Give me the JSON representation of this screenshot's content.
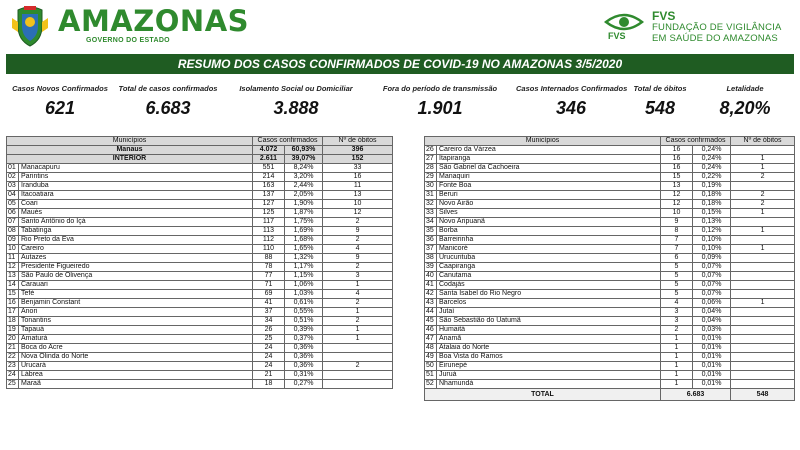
{
  "header": {
    "brand_name": "AMAZONAS",
    "brand_sub": "GOVERNO DO ESTADO",
    "fvs_abbr": "FVS",
    "fvs_line1": "FUNDAÇÃO DE VIGILÂNCIA",
    "fvs_line2": "EM SAÚDE DO AMAZONAS"
  },
  "banner": "RESUMO DOS CASOS CONFIRMADOS DE COVID-19 NO AMAZONAS 3/5/2020",
  "stats": [
    {
      "label": "Casos Novos Confirmados",
      "value": "621"
    },
    {
      "label": "Total de casos confirmados",
      "value": "6.683"
    },
    {
      "label": "Isolamento Social ou Domiciliar",
      "value": "3.888"
    },
    {
      "label": "Fora do período de transmissão",
      "value": "1.901"
    },
    {
      "label": "Casos Internados Confirmados",
      "value": "346"
    },
    {
      "label": "Total de óbitos",
      "value": "548"
    },
    {
      "label": "Letalidade",
      "value": "8,20%"
    }
  ],
  "table_headers": {
    "municipios": "Municípios",
    "casos": "Casos confirmados",
    "obitos": "Nº de óbitos"
  },
  "summary_rows": [
    {
      "name": "Manaus",
      "cases": "4.072",
      "pct": "60,93%",
      "deaths": "396"
    },
    {
      "name": "INTERIOR",
      "cases": "2.611",
      "pct": "39,07%",
      "deaths": "152"
    }
  ],
  "left_rows": [
    {
      "n": "01",
      "name": "Manacapuru",
      "cases": "551",
      "pct": "8,24%",
      "deaths": "33"
    },
    {
      "n": "02",
      "name": "Parintins",
      "cases": "214",
      "pct": "3,20%",
      "deaths": "16"
    },
    {
      "n": "03",
      "name": "Iranduba",
      "cases": "163",
      "pct": "2,44%",
      "deaths": "11"
    },
    {
      "n": "04",
      "name": "Itacoatiara",
      "cases": "137",
      "pct": "2,05%",
      "deaths": "13"
    },
    {
      "n": "05",
      "name": "Coari",
      "cases": "127",
      "pct": "1,90%",
      "deaths": "10"
    },
    {
      "n": "06",
      "name": "Maués",
      "cases": "125",
      "pct": "1,87%",
      "deaths": "12"
    },
    {
      "n": "07",
      "name": "Santo Antônio do Içá",
      "cases": "117",
      "pct": "1,75%",
      "deaths": "2"
    },
    {
      "n": "08",
      "name": "Tabatinga",
      "cases": "113",
      "pct": "1,69%",
      "deaths": "9"
    },
    {
      "n": "09",
      "name": "Rio Preto da Eva",
      "cases": "112",
      "pct": "1,68%",
      "deaths": "2"
    },
    {
      "n": "10",
      "name": "Careiro",
      "cases": "110",
      "pct": "1,65%",
      "deaths": "4"
    },
    {
      "n": "11",
      "name": "Autazes",
      "cases": "88",
      "pct": "1,32%",
      "deaths": "9"
    },
    {
      "n": "12",
      "name": "Presidente Figueiredo",
      "cases": "78",
      "pct": "1,17%",
      "deaths": "2"
    },
    {
      "n": "13",
      "name": "São Paulo de Olivença",
      "cases": "77",
      "pct": "1,15%",
      "deaths": "3"
    },
    {
      "n": "14",
      "name": "Carauari",
      "cases": "71",
      "pct": "1,06%",
      "deaths": "1"
    },
    {
      "n": "15",
      "name": "Tefé",
      "cases": "69",
      "pct": "1,03%",
      "deaths": "4"
    },
    {
      "n": "16",
      "name": "Benjamin Constant",
      "cases": "41",
      "pct": "0,61%",
      "deaths": "2"
    },
    {
      "n": "17",
      "name": "Anori",
      "cases": "37",
      "pct": "0,55%",
      "deaths": "1"
    },
    {
      "n": "18",
      "name": "Tonantins",
      "cases": "34",
      "pct": "0,51%",
      "deaths": "2"
    },
    {
      "n": "19",
      "name": "Tapauá",
      "cases": "26",
      "pct": "0,39%",
      "deaths": "1"
    },
    {
      "n": "20",
      "name": "Amaturá",
      "cases": "25",
      "pct": "0,37%",
      "deaths": "1"
    },
    {
      "n": "21",
      "name": "Boca do Acre",
      "cases": "24",
      "pct": "0,36%",
      "deaths": ""
    },
    {
      "n": "22",
      "name": "Nova Olinda do Norte",
      "cases": "24",
      "pct": "0,36%",
      "deaths": ""
    },
    {
      "n": "23",
      "name": "Urucará",
      "cases": "24",
      "pct": "0,36%",
      "deaths": "2"
    },
    {
      "n": "24",
      "name": "Lábrea",
      "cases": "21",
      "pct": "0,31%",
      "deaths": ""
    },
    {
      "n": "25",
      "name": "Maraã",
      "cases": "18",
      "pct": "0,27%",
      "deaths": ""
    }
  ],
  "right_rows": [
    {
      "n": "26",
      "name": "Careiro da Várzea",
      "cases": "16",
      "pct": "0,24%",
      "deaths": ""
    },
    {
      "n": "27",
      "name": "Itapiranga",
      "cases": "16",
      "pct": "0,24%",
      "deaths": "1"
    },
    {
      "n": "28",
      "name": "São Gabriel da Cachoeira",
      "cases": "16",
      "pct": "0,24%",
      "deaths": "1"
    },
    {
      "n": "29",
      "name": "Manaquiri",
      "cases": "15",
      "pct": "0,22%",
      "deaths": "2"
    },
    {
      "n": "30",
      "name": "Fonte Boa",
      "cases": "13",
      "pct": "0,19%",
      "deaths": ""
    },
    {
      "n": "31",
      "name": "Beruri",
      "cases": "12",
      "pct": "0,18%",
      "deaths": "2"
    },
    {
      "n": "32",
      "name": "Novo Airão",
      "cases": "12",
      "pct": "0,18%",
      "deaths": "2"
    },
    {
      "n": "33",
      "name": "Silves",
      "cases": "10",
      "pct": "0,15%",
      "deaths": "1"
    },
    {
      "n": "34",
      "name": "Novo Aripuanã",
      "cases": "9",
      "pct": "0,13%",
      "deaths": ""
    },
    {
      "n": "35",
      "name": "Borba",
      "cases": "8",
      "pct": "0,12%",
      "deaths": "1"
    },
    {
      "n": "36",
      "name": "Barreirinha",
      "cases": "7",
      "pct": "0,10%",
      "deaths": ""
    },
    {
      "n": "37",
      "name": "Manicoré",
      "cases": "7",
      "pct": "0,10%",
      "deaths": "1"
    },
    {
      "n": "38",
      "name": "Urucurituba",
      "cases": "6",
      "pct": "0,09%",
      "deaths": ""
    },
    {
      "n": "39",
      "name": "Caapiranga",
      "cases": "5",
      "pct": "0,07%",
      "deaths": ""
    },
    {
      "n": "40",
      "name": "Canutama",
      "cases": "5",
      "pct": "0,07%",
      "deaths": ""
    },
    {
      "n": "41",
      "name": "Codajás",
      "cases": "5",
      "pct": "0,07%",
      "deaths": ""
    },
    {
      "n": "42",
      "name": "Santa Isabel do Rio Negro",
      "cases": "5",
      "pct": "0,07%",
      "deaths": ""
    },
    {
      "n": "43",
      "name": "Barcelos",
      "cases": "4",
      "pct": "0,06%",
      "deaths": "1"
    },
    {
      "n": "44",
      "name": "Jutaí",
      "cases": "3",
      "pct": "0,04%",
      "deaths": ""
    },
    {
      "n": "45",
      "name": "São Sebastião do Uatumã",
      "cases": "3",
      "pct": "0,04%",
      "deaths": ""
    },
    {
      "n": "46",
      "name": "Humaitá",
      "cases": "2",
      "pct": "0,03%",
      "deaths": ""
    },
    {
      "n": "47",
      "name": "Anamã",
      "cases": "1",
      "pct": "0,01%",
      "deaths": ""
    },
    {
      "n": "48",
      "name": "Atalaia do Norte",
      "cases": "1",
      "pct": "0,01%",
      "deaths": ""
    },
    {
      "n": "49",
      "name": "Boa Vista do Ramos",
      "cases": "1",
      "pct": "0,01%",
      "deaths": ""
    },
    {
      "n": "50",
      "name": "Eirunepé",
      "cases": "1",
      "pct": "0,01%",
      "deaths": ""
    },
    {
      "n": "51",
      "name": "Juruá",
      "cases": "1",
      "pct": "0,01%",
      "deaths": ""
    },
    {
      "n": "52",
      "name": "Nhamundá",
      "cases": "1",
      "pct": "0,01%",
      "deaths": ""
    }
  ],
  "total": {
    "label": "TOTAL",
    "cases": "6.683",
    "deaths": "548"
  },
  "colors": {
    "brand_green": "#2f8a2e",
    "banner_green": "#1f5c22",
    "header_gray": "#d9d9d9"
  }
}
